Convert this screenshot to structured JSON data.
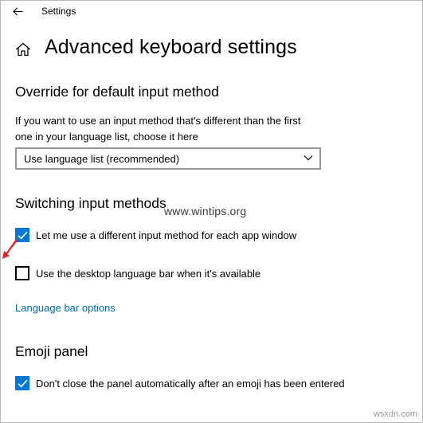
{
  "window": {
    "title": "Settings"
  },
  "page": {
    "title": "Advanced keyboard settings"
  },
  "override": {
    "heading": "Override for default input method",
    "description": "If you want to use an input method that's different than the first one in your language list, choose it here",
    "select_value": "Use language list (recommended)"
  },
  "switching": {
    "heading": "Switching input methods",
    "options": [
      {
        "label": "Let me use a different input method for each app window",
        "checked": true
      },
      {
        "label": "Use the desktop language bar when it's available",
        "checked": false
      }
    ],
    "link": "Language bar options"
  },
  "emoji": {
    "heading": "Emoji panel",
    "options": [
      {
        "label": "Don't close the panel automatically after an emoji has been entered",
        "checked": true
      }
    ]
  },
  "watermark": {
    "text": "www.wintips.org",
    "corner": "wsxdn.com"
  },
  "colors": {
    "accent": "#0078d7",
    "link": "#0067b8",
    "annotation_arrow": "#e8202a"
  },
  "icons": [
    "back-arrow-icon",
    "home-icon",
    "chevron-down-icon",
    "checkmark-icon",
    "red-pointer-arrow-icon"
  ]
}
